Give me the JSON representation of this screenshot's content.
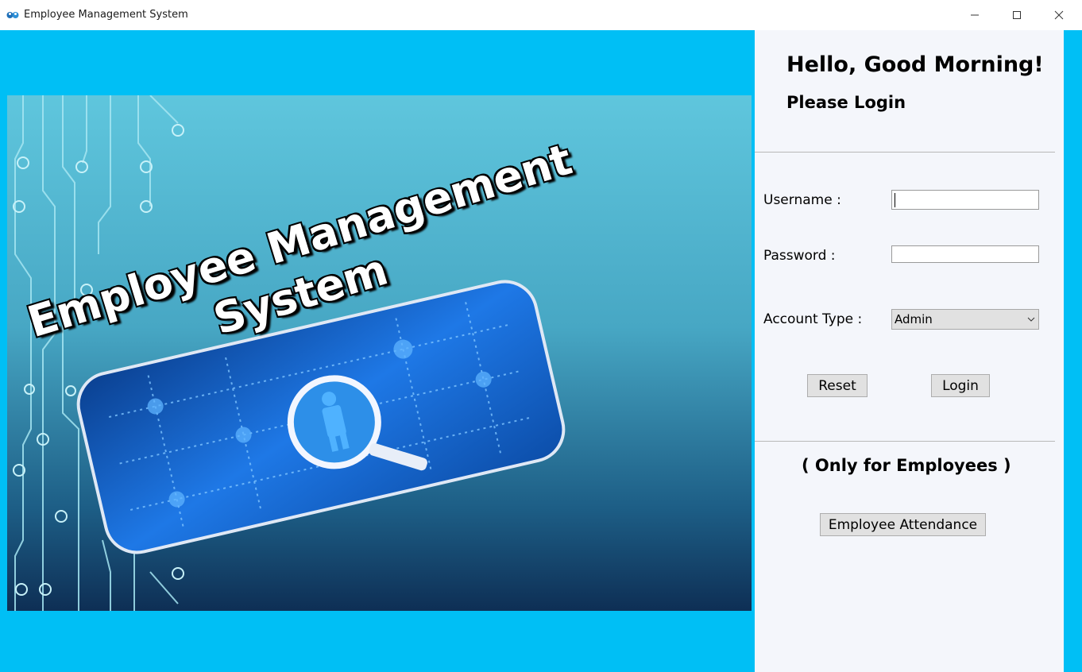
{
  "window": {
    "title": "Employee Management System",
    "app_icon": "people-logo-icon",
    "controls": [
      "minimize-icon",
      "maximize-icon",
      "close-icon"
    ]
  },
  "hero": {
    "headline_line1": "Employee Management",
    "headline_line2": "System"
  },
  "login": {
    "greeting": "Hello, Good Morning!",
    "prompt": "Please Login",
    "username_label": "Username :",
    "username_value": "",
    "password_label": "Password :",
    "password_value": "",
    "account_type_label": "Account Type :",
    "account_type_value": "Admin",
    "reset_label": "Reset",
    "login_label": "Login"
  },
  "employees": {
    "note": "( Only for Employees )",
    "attendance_label": "Employee Attendance"
  },
  "colors": {
    "accent": "#00bff5",
    "panel_bg": "#f4f6fb",
    "button_bg": "#e1e1e1"
  }
}
